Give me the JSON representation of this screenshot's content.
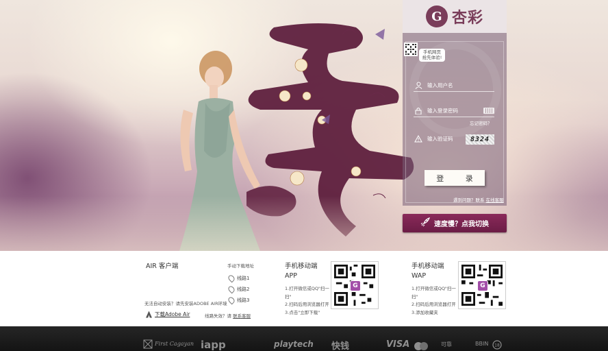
{
  "login": {
    "logo_glyph": "G",
    "logo_text": "杏彩",
    "mobile_tip_line1": "手机网页",
    "mobile_tip_line2": "抢先体验!",
    "username_placeholder": "输入用户名",
    "password_placeholder": "输入登录密码",
    "forgot_password": "忘记密码？",
    "captcha_placeholder": "输入验证码",
    "captcha_value": "8324",
    "login_button": "登 录",
    "help_prefix": "遇到问题？联系",
    "help_link": "在线客服",
    "speed_button": "速度慢？点我切换"
  },
  "download": {
    "air": {
      "title": "AIR 客户端",
      "manual_label": "手动下载地址",
      "lines": [
        "线路1",
        "线路2",
        "线路3"
      ],
      "note": "无法自动安装？请先安装ADOBE AIR环境",
      "adobe_link": "下载Adobe Air",
      "invalid_prefix": "线路失效？请",
      "invalid_link": "联系客服"
    },
    "app": {
      "title_line1": "手机移动端",
      "title_line2": "APP",
      "steps": [
        "1.打开微信或QQ\"扫一",
        "扫\"",
        "2.扫码后用浏览器打开",
        "3.点击\"立即下载\""
      ]
    },
    "wap": {
      "title_line1": "手机移动端",
      "title_line2": "WAP",
      "steps": [
        "1.打开微信或QQ\"扫一",
        "扫\"",
        "2.扫码后用浏览器打开",
        "3.添加收藏夹"
      ]
    }
  },
  "footer": {
    "partners": [
      "First Cagayan",
      "iapp",
      "playtech",
      "快钱",
      "VISA",
      "MasterCard",
      "可靠",
      "BBIN",
      "18+"
    ]
  }
}
